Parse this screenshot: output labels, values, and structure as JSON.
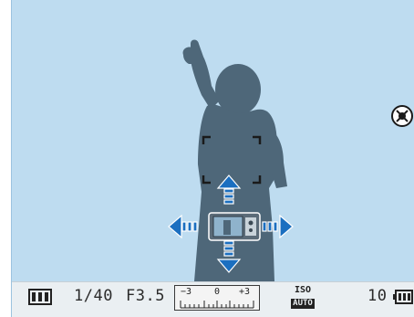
{
  "status_bar": {
    "shutter_speed": "1/40",
    "aperture": "F3.5",
    "ev_scale": {
      "min": "−3",
      "mid": "0",
      "max": "+3"
    },
    "iso": {
      "top": "ISO",
      "bottom": "AUTO"
    },
    "shots_remaining": "10",
    "icons": [
      "frame-mode-icon",
      "battery-icon"
    ]
  },
  "viewfinder": {
    "icons": [
      "subject-silhouette",
      "af-focus-frame",
      "camera-move-guide-icon",
      "arrow-up-icon",
      "arrow-down-icon",
      "arrow-left-icon",
      "arrow-right-icon",
      "stabilizer-off-icon"
    ],
    "colors": {
      "sky": "#bedcf0",
      "silhouette": "#4e6779",
      "arrow": "#1b6fc0",
      "bar": "#eaeff2"
    }
  }
}
